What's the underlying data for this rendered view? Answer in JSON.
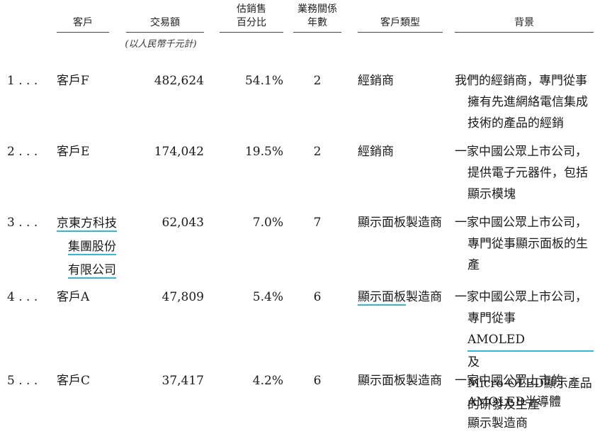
{
  "headers": {
    "customer": "客戶",
    "amount": "交易額",
    "amount_unit": "(以人民幣千元計)",
    "percentage": "估銷售\n百分比",
    "years": "業務關係\n年數",
    "type": "客戶類型",
    "background": "背景"
  },
  "rows": [
    {
      "index": "1 . . .",
      "customer": "客戶F",
      "amount": "482,624",
      "percentage": "54.1%",
      "years": "2",
      "type": "經銷商",
      "background": [
        "我們的經銷商，專門從事",
        "擁有先進網絡電信集成",
        "技術的產品的經銷"
      ]
    },
    {
      "index": "2 . . .",
      "customer": "客戶E",
      "amount": "174,042",
      "percentage": "19.5%",
      "years": "2",
      "type": "經銷商",
      "background": [
        "一家中國公眾上市公司，",
        "提供電子元器件，包括",
        "顯示模塊"
      ]
    },
    {
      "index": "3 . . .",
      "customer": [
        "京東方科技",
        "集團股份",
        "有限公司"
      ],
      "amount": "62,043",
      "percentage": "7.0%",
      "years": "7",
      "type": "顯示面板製造商",
      "background": [
        "一家中國公眾上市公司，",
        "專門從事顯示面板的生",
        "產"
      ]
    },
    {
      "index": "4 . . .",
      "customer": "客戶A",
      "amount": "47,809",
      "percentage": "5.4%",
      "years": "6",
      "type_marked": "顯示面板",
      "type_rest": "製造商",
      "background": {
        "0": "一家中國公眾上市公司，",
        "1a": "專門從事",
        "1b": "AMOLED",
        "1c": "及",
        "2": "Micro-OLED顯示產品",
        "3": "的研發及生產"
      }
    },
    {
      "index": "5 . . .",
      "customer": "客戶C",
      "amount": "37,417",
      "percentage": "4.2%",
      "years": "6",
      "type": "顯示面板製造商",
      "background": [
        "一家中國公眾上市的",
        "AMOLED半導體",
        "顯示製造商"
      ]
    }
  ]
}
